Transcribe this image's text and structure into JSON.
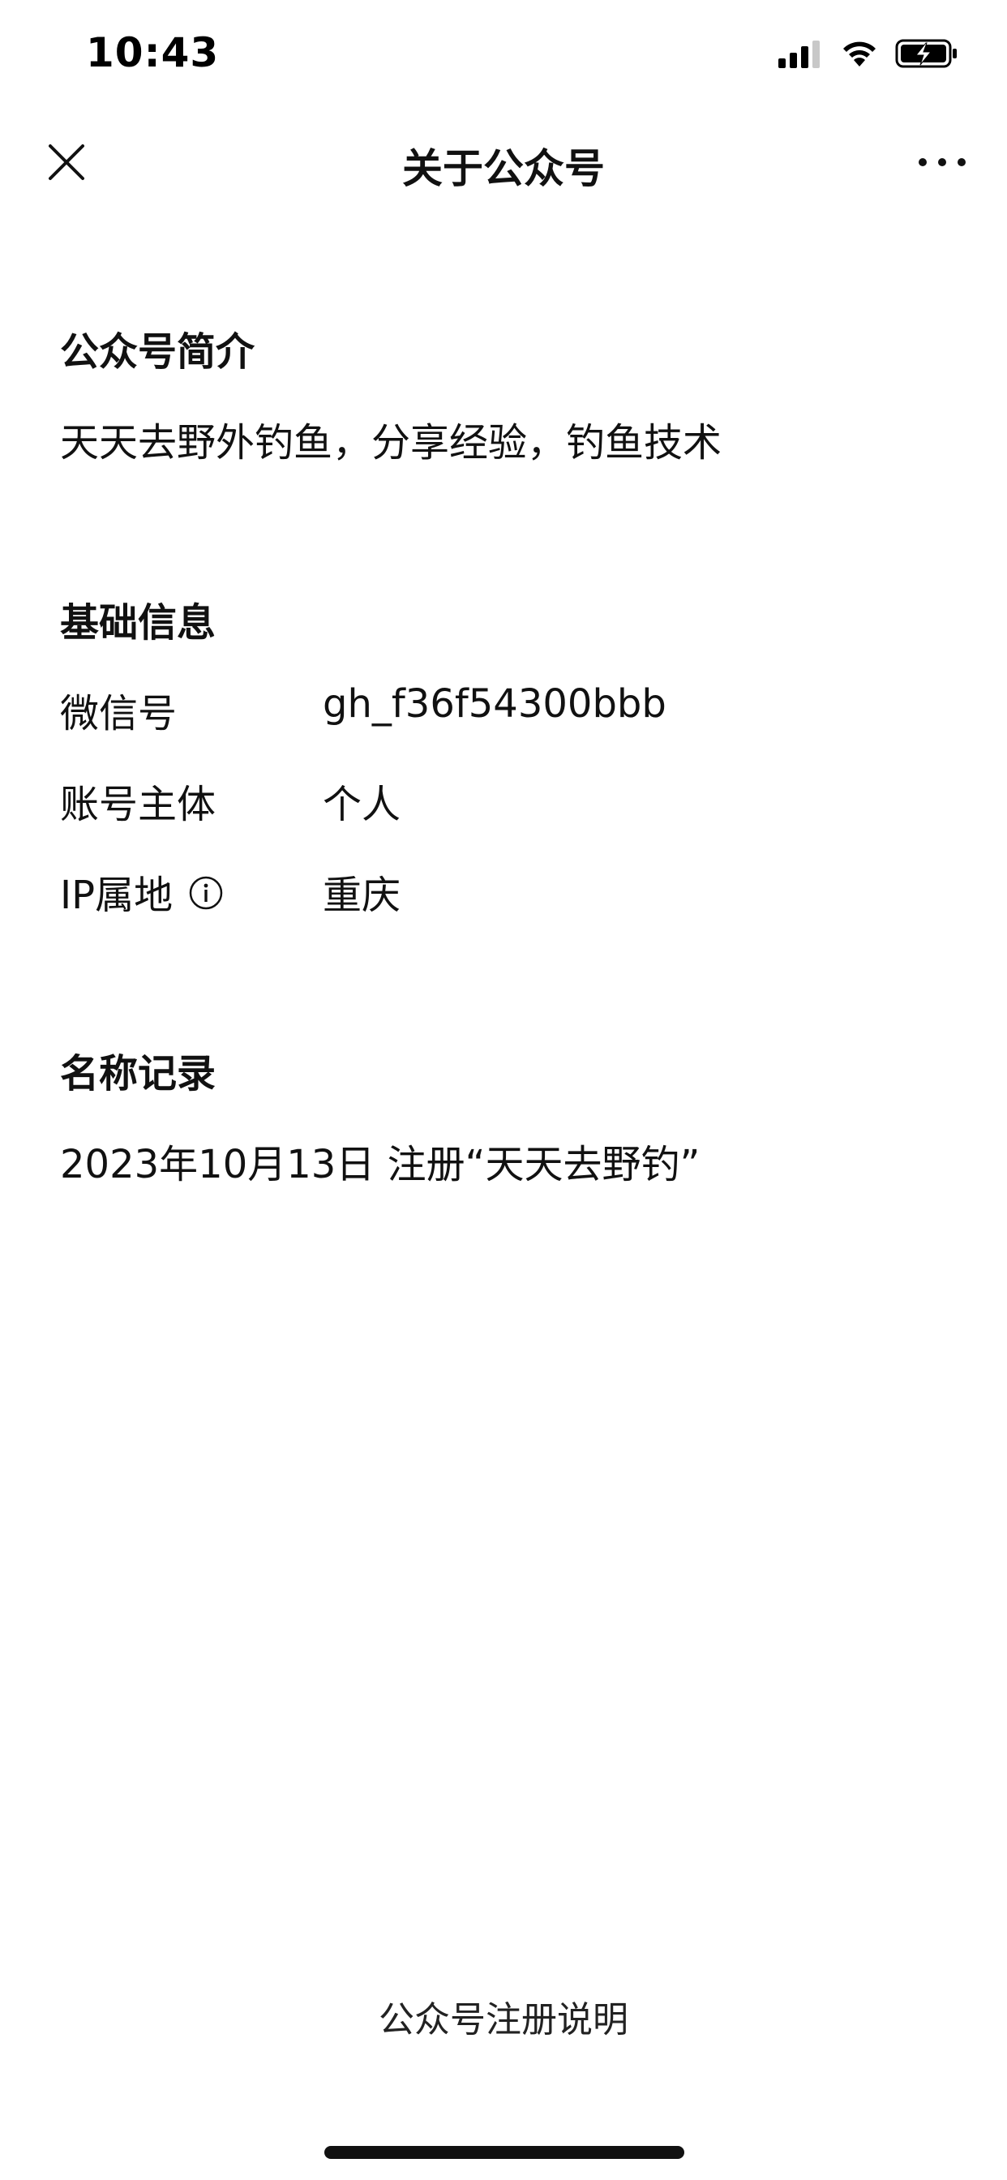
{
  "status_bar": {
    "time": "10:43"
  },
  "nav": {
    "title": "关于公众号"
  },
  "intro": {
    "heading": "公众号简介",
    "text": "天天去野外钓鱼，分享经验，钓鱼技术"
  },
  "basic_info": {
    "heading": "基础信息",
    "rows": [
      {
        "label": "微信号",
        "value": "gh_f36f54300bbb"
      },
      {
        "label": "账号主体",
        "value": "个人"
      },
      {
        "label": "IP属地",
        "value": "重庆"
      }
    ]
  },
  "name_history": {
    "heading": "名称记录",
    "entries": [
      "2023年10月13日 注册“天天去野钓”"
    ]
  },
  "footer": {
    "link": "公众号注册说明"
  },
  "icons": {
    "close": "close-icon",
    "more": "more-icon",
    "info": "info-icon",
    "signal": "signal-icon",
    "wifi": "wifi-icon",
    "battery": "battery-charging-icon"
  },
  "colors": {
    "text": "#111111",
    "background": "#ffffff"
  }
}
